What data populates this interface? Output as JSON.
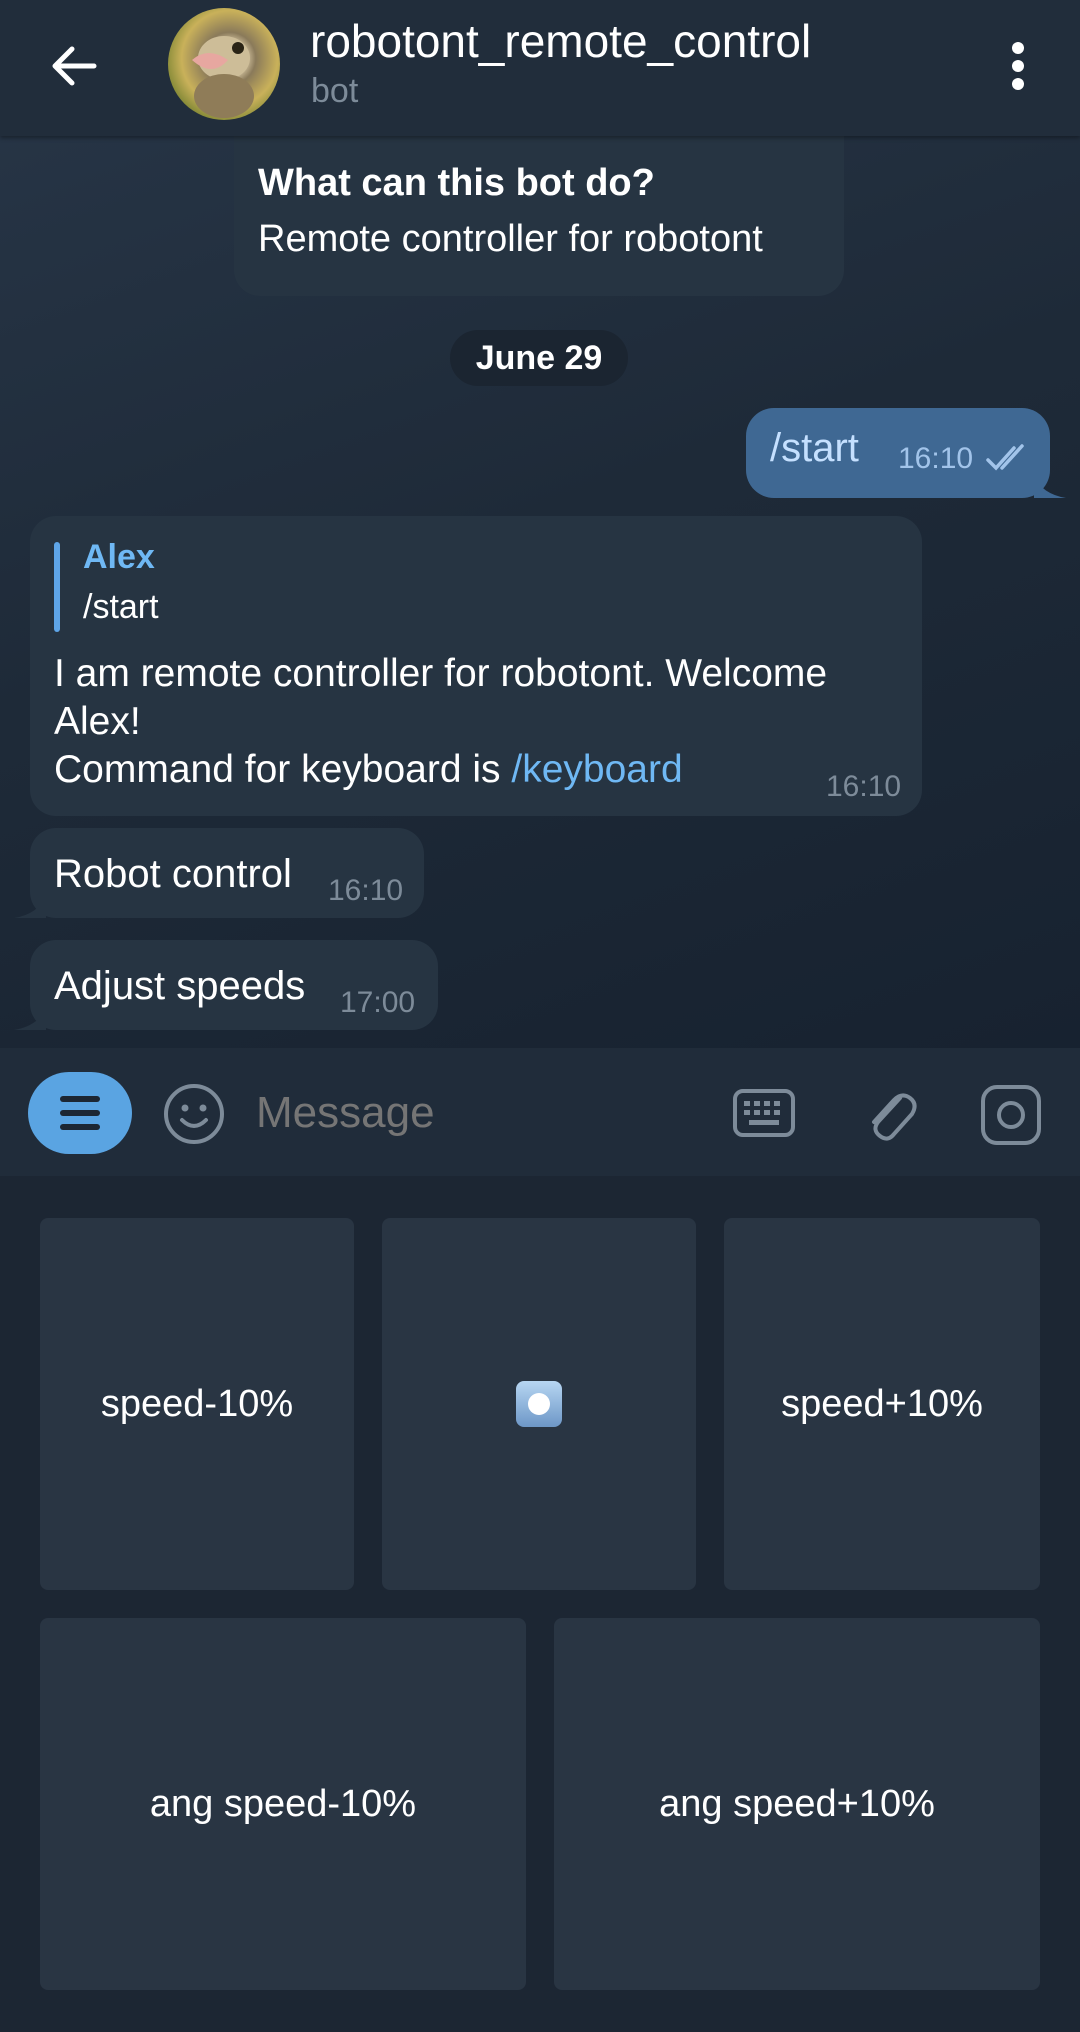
{
  "header": {
    "title": "robotont_remote_control",
    "subtitle": "bot"
  },
  "chat": {
    "intro_question": "What can this bot do?",
    "intro_answer": "Remote controller for robotont",
    "date": "June 29",
    "outgoing": {
      "text": "/start",
      "time": "16:10"
    },
    "reply": {
      "reply_name": "Alex",
      "reply_text": "/start",
      "line1": "I am remote controller for robotont. Welcome",
      "line2": "Alex!",
      "line3_prefix": "Command for keyboard is ",
      "line3_link": "/keyboard",
      "time": "16:10"
    },
    "msg1": {
      "text": "Robot control",
      "time": "16:10"
    },
    "msg2": {
      "text": "Adjust speeds",
      "time": "17:00"
    }
  },
  "composer": {
    "placeholder": "Message"
  },
  "keyboard": {
    "row1": [
      "speed-10%",
      "speed+10%"
    ],
    "row2": [
      "ang speed-10%",
      "ang speed+10%"
    ],
    "center_icon": "record-button-icon"
  }
}
